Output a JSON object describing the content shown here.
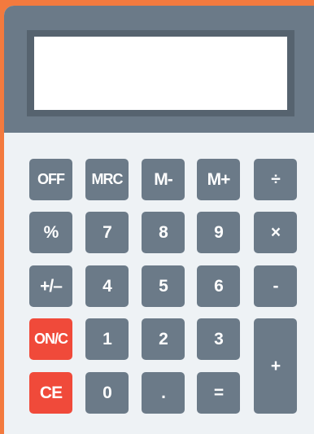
{
  "display": {
    "value": ""
  },
  "keys": {
    "off": "OFF",
    "mrc": "MRC",
    "m_minus": "M-",
    "m_plus": "M+",
    "divide": "÷",
    "percent": "%",
    "seven": "7",
    "eight": "8",
    "nine": "9",
    "multiply": "×",
    "plus_minus": "+/–",
    "four": "4",
    "five": "5",
    "six": "6",
    "minus": "-",
    "on_c": "ON/C",
    "one": "1",
    "two": "2",
    "three": "3",
    "plus": "+",
    "ce": "CE",
    "zero": "0",
    "decimal": ".",
    "equals": "="
  },
  "colors": {
    "background": "#f37a3e",
    "body": "#eef2f5",
    "top_panel": "#6b7a88",
    "display_frame": "#56636f",
    "display": "#ffffff",
    "key": "#6b7a88",
    "key_red": "#f04a3a",
    "key_text": "#ffffff"
  }
}
